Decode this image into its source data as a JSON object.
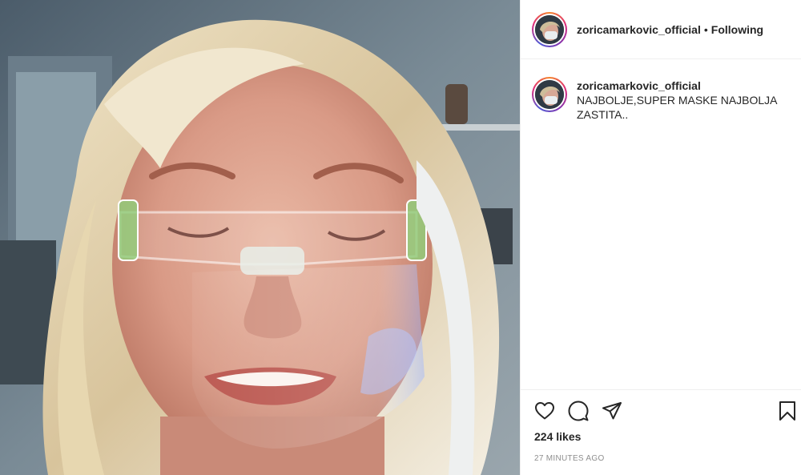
{
  "post": {
    "username": "zoricamarkovic_official",
    "separator": "•",
    "follow_status": "Following",
    "caption": {
      "username": "zoricamarkovic_official",
      "text": "NAJBOLJE,SUPER MASKE NAJBOLJA ZASTITA.."
    },
    "likes": "224 likes",
    "timestamp": "27 MINUTES AGO"
  },
  "icons": {
    "like": "heart-icon",
    "comment": "comment-icon",
    "share": "paper-plane-icon",
    "save": "bookmark-icon"
  }
}
